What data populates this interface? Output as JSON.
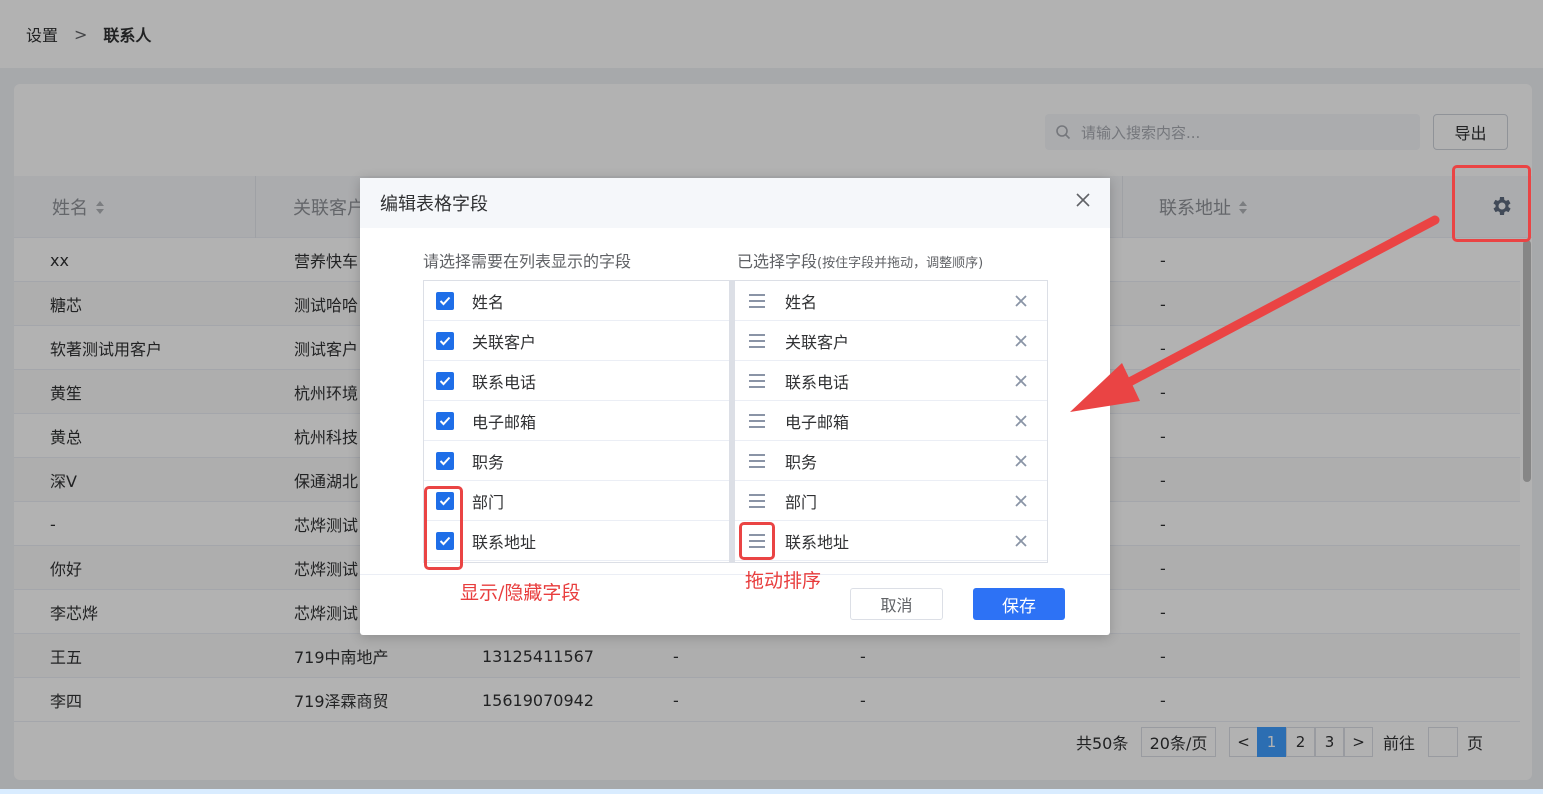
{
  "breadcrumb": {
    "parent": "设置",
    "separator": ">",
    "current": "联系人"
  },
  "toolbar": {
    "search_placeholder": "请输入搜索内容...",
    "export_label": "导出"
  },
  "table": {
    "headers": {
      "name": "姓名",
      "customer": "关联客户",
      "address": "联系地址"
    },
    "rows": [
      {
        "name": "xx",
        "customer": "营养快车",
        "phone": "",
        "email": "",
        "title": "",
        "address": "-"
      },
      {
        "name": "糖芯",
        "customer": "测试哈哈",
        "phone": "",
        "email": "",
        "title": "",
        "address": "-"
      },
      {
        "name": "软著测试用客户",
        "customer": "测试客户",
        "phone": "",
        "email": "",
        "title": "",
        "address": "-"
      },
      {
        "name": "黄笙",
        "customer": "杭州环境",
        "phone": "",
        "email": "",
        "title": "",
        "address": "-"
      },
      {
        "name": "黄总",
        "customer": "杭州科技",
        "phone": "",
        "email": "",
        "title": "",
        "address": "-"
      },
      {
        "name": "深V",
        "customer": "保通湖北",
        "phone": "",
        "email": "",
        "title": "",
        "address": "-"
      },
      {
        "name": "-",
        "customer": "芯烨测试",
        "phone": "",
        "email": "",
        "title": "",
        "address": "-"
      },
      {
        "name": "你好",
        "customer": "芯烨测试",
        "phone": "",
        "email": "",
        "title": "",
        "address": "-"
      },
      {
        "name": "李芯烨",
        "customer": "芯烨测试",
        "phone": "",
        "email": "",
        "title": "",
        "address": "-"
      },
      {
        "name": "王五",
        "customer": "719中南地产",
        "phone": "13125411567",
        "email": "-",
        "title": "-",
        "address": "-"
      },
      {
        "name": "李四",
        "customer": "719泽霖商贸",
        "phone": "15619070942",
        "email": "-",
        "title": "-",
        "address": "-"
      }
    ]
  },
  "pagination": {
    "total": "共50条",
    "page_size": "20条/页",
    "prev": "<",
    "next": ">",
    "pages": [
      "1",
      "2",
      "3"
    ],
    "goto_label": "前往",
    "page_unit": "页"
  },
  "dialog": {
    "title": "编辑表格字段",
    "left_title": "请选择需要在列表显示的字段",
    "right_title": "已选择字段",
    "right_hint": "(按住字段并拖动，调整顺序)",
    "fields": [
      "姓名",
      "关联客户",
      "联系电话",
      "电子邮箱",
      "职务",
      "部门",
      "联系地址"
    ],
    "cancel_label": "取消",
    "save_label": "保存"
  },
  "annotations": {
    "toggle_note": "显示/隐藏字段",
    "drag_note": "拖动排序"
  },
  "colors": {
    "primary": "#2d72f5",
    "checkbox": "#1e6ee8",
    "annotation_red": "#ea4444"
  }
}
